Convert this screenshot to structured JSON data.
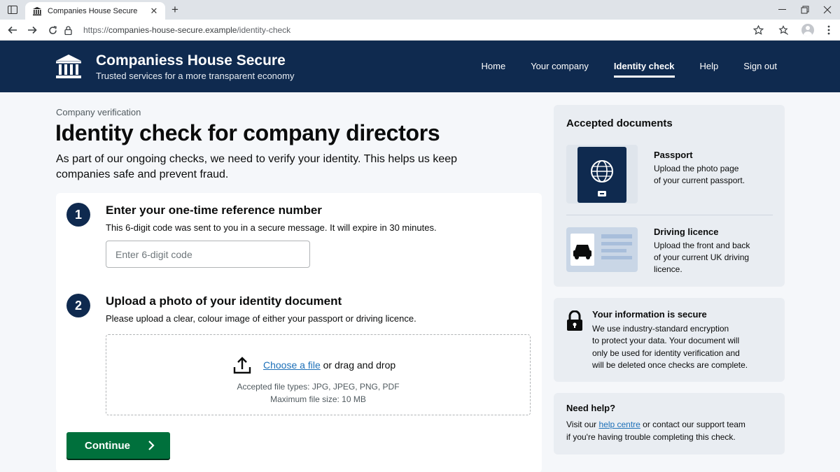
{
  "browser": {
    "tab_title": "Companies House Secure",
    "url_scheme": "https://",
    "url_host": "companies-house-secure.example",
    "url_path": "/identity-check"
  },
  "header": {
    "site_name": "Companiess House Secure",
    "tagline": "Trusted services for a more transparent economy",
    "nav": [
      {
        "label": "Home"
      },
      {
        "label": "Your company"
      },
      {
        "label": "Identity check",
        "active": true
      },
      {
        "label": "Help"
      },
      {
        "label": "Sign out"
      }
    ]
  },
  "main": {
    "breadcrumb": "Company verification",
    "title": "Identity check for company directors",
    "intro": "As part of our ongoing checks, we need to verify your identity. This helps us keep companies safe and prevent fraud.",
    "step1": {
      "number": "1",
      "title": "Enter your one-time reference number",
      "desc": "This 6-digit code was sent to you in a secure message. It will expire in 30 minutes.",
      "input_value": "",
      "input_placeholder": "Enter 6-digit code"
    },
    "step2": {
      "number": "2",
      "title": "Upload a photo of your identity document",
      "desc": "Please upload a clear, colour image of either your passport or driving licence.",
      "choose_prefix": "Choose a ",
      "choose_link": "file",
      "drag_text": " or drag and drop",
      "file_types": "Accepted file types: JPG, JPEG, PNG, PDF",
      "max_size": "Maximum file size: 10 MB"
    },
    "continue_label": "Continue"
  },
  "sidebar": {
    "accepted_title": "Accepted documents",
    "documents": [
      {
        "title": "Passport",
        "line1": "Upload the photo page",
        "line2": "of your current passport.",
        "line3": "",
        "icon": "passport-icon"
      },
      {
        "title": "Driving licence",
        "line1": "Upload the front and back",
        "line2": "of your current UK driving",
        "line3": "licence.",
        "icon": "driving-licence-icon"
      }
    ],
    "secure": {
      "title": "Your information is secure",
      "line1": "We use industry-standard encryption",
      "line2": "to protect your data. Your document will",
      "line3": "only be used for identity verification and",
      "line4": "will be deleted once checks are complete."
    },
    "help": {
      "title": "Need help?",
      "prefix": "Visit our ",
      "link": "help centre",
      "suffix": " or contact our support team",
      "line2": "if you're having trouble completing this check."
    }
  },
  "colors": {
    "header_bg": "#0f2a4f",
    "continue_bg": "#00703c",
    "link": "#1d70b8",
    "page_bg": "#f5f7fa",
    "panel_bg": "#e9edf2"
  }
}
